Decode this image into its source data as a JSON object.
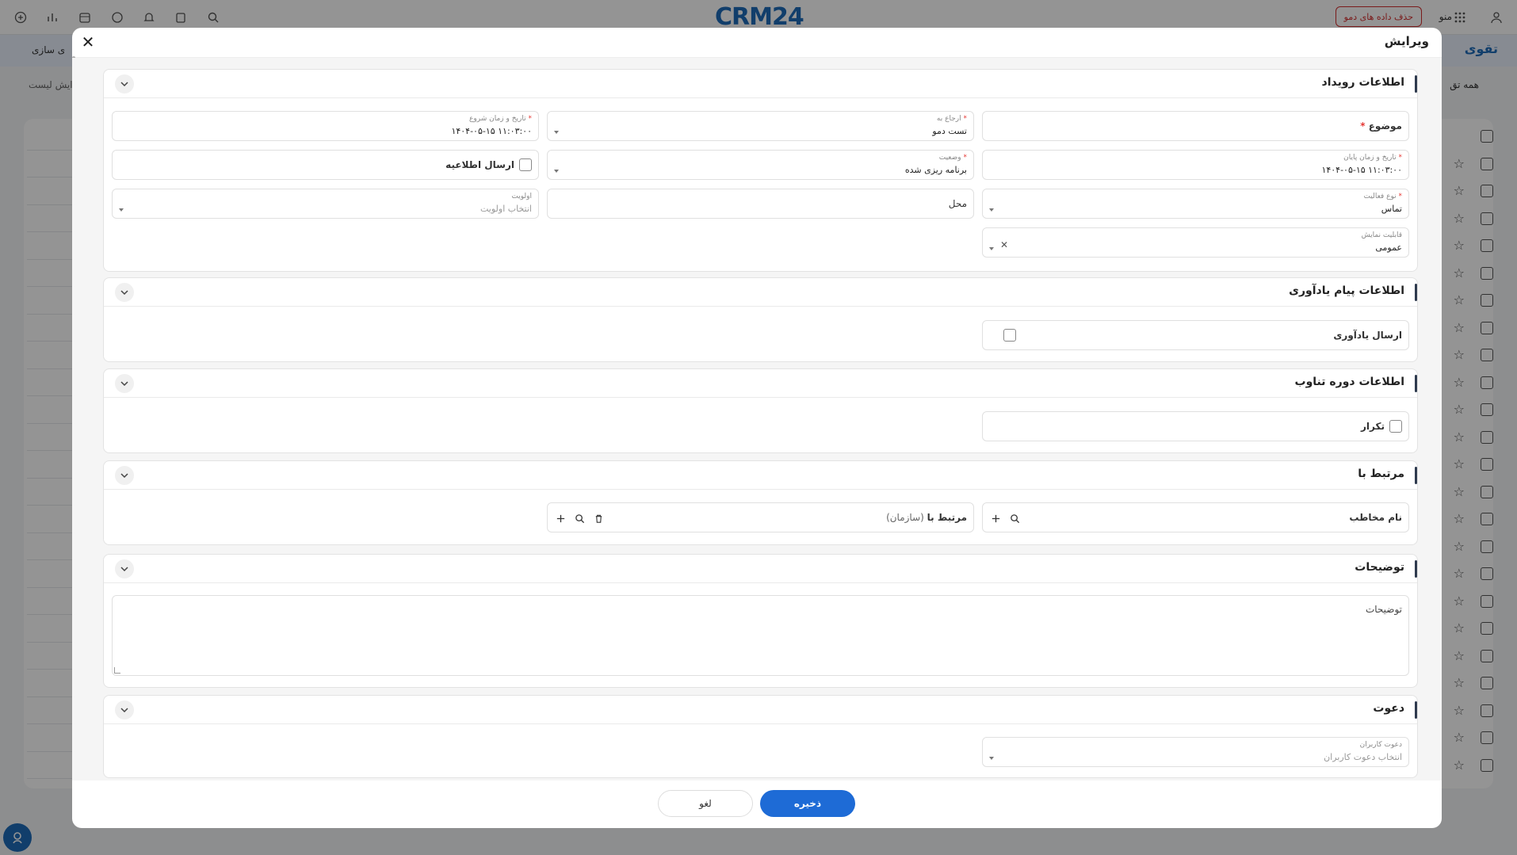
{
  "app": {
    "logo_text": "CRM24",
    "delete_demo_label": "حذف داده های دمو",
    "menu_label": "منو",
    "page_title": "تقوی",
    "sub_title": "ی سازی",
    "left_label": "ایش لیست",
    "right_label": "همه تق"
  },
  "modal": {
    "title": "ویرایش",
    "sections": {
      "event": {
        "title": "اطلاعات رویداد",
        "subject_label": "موضوع",
        "assigned_label": "ارجاع به",
        "assigned_value": "تست دمو",
        "start_label": "تاریخ و زمان شروع",
        "start_value": "۱۴۰۴-۰۵-۱۵ ۱۱:۰۳:۰۰",
        "end_label": "تاریخ و زمان پایان",
        "end_value": "۱۴۰۴-۰۵-۱۵ ۱۱:۰۳:۰۰",
        "status_label": "وضعیت",
        "status_value": "برنامه ریزی شده",
        "notify_label": "ارسال اطلاعیه",
        "activity_label": "نوع فعالیت",
        "activity_value": "تماس",
        "location_label": "محل",
        "priority_label": "اولویت",
        "priority_placeholder": "انتخاب اولویت",
        "visibility_label": "قابلیت نمایش",
        "visibility_value": "عمومی"
      },
      "reminder": {
        "title": "اطلاعات پیام یادآوری",
        "send_reminder_label": "ارسال یادآوری"
      },
      "recurrence": {
        "title": "اطلاعات دوره تناوب",
        "repeat_label": "تکرار"
      },
      "related": {
        "title": "مرتبط با",
        "contact_label": "نام مخاطب",
        "related_label": "مرتبط با",
        "related_hint": "(سازمان)"
      },
      "description": {
        "title": "توضیحات",
        "placeholder": "توضیحات"
      },
      "invite": {
        "title": "دعوت",
        "users_label": "دعوت کاربران",
        "users_placeholder": "انتخاب دعوت کاربران"
      }
    },
    "footer": {
      "save_label": "ذخیره",
      "cancel_label": "لغو"
    }
  },
  "colors": {
    "primary": "#1e6bd6",
    "required": "#e53935",
    "brand": "#1e6bb8"
  }
}
